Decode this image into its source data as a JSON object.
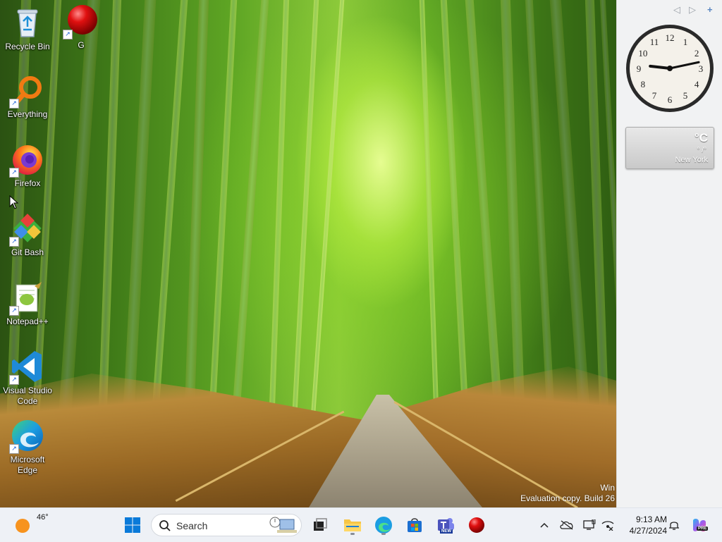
{
  "desktop": {
    "icons": [
      {
        "label": "Recycle Bin"
      },
      {
        "label": "G"
      },
      {
        "label": "Everything"
      },
      {
        "label": "Firefox"
      },
      {
        "label": "Git Bash"
      },
      {
        "label": "Notepad++"
      },
      {
        "label": "Visual Studio Code"
      },
      {
        "label": "Microsoft Edge"
      }
    ],
    "watermark": {
      "line1": "Win",
      "line2": "Evaluation copy. Build 26"
    }
  },
  "sidebar": {
    "clock": {
      "hour": 9,
      "minute": 13
    },
    "weather": {
      "temp": "°C",
      "range": "° /°",
      "city": "New York"
    }
  },
  "taskbar": {
    "weather_temp": "46°",
    "search_placeholder": "Search",
    "time": "9:13 AM",
    "date": "4/27/2024",
    "copilot_badge": "PRE",
    "teams_badge": "NEW",
    "icons": [
      "start-icon",
      "search-icon",
      "task-view-icon",
      "file-explorer-icon",
      "edge-icon",
      "store-icon",
      "teams-icon",
      "g-app-icon"
    ],
    "tray_icons": [
      "show-hidden-icon",
      "onedrive-icon",
      "display-icon",
      "network-icon",
      "notifications-icon",
      "copilot-icon"
    ]
  },
  "colors": {
    "taskbar_bg": "#eef1f6",
    "sidebar_bg": "#f1f2f3",
    "accent": "#0067c0"
  }
}
